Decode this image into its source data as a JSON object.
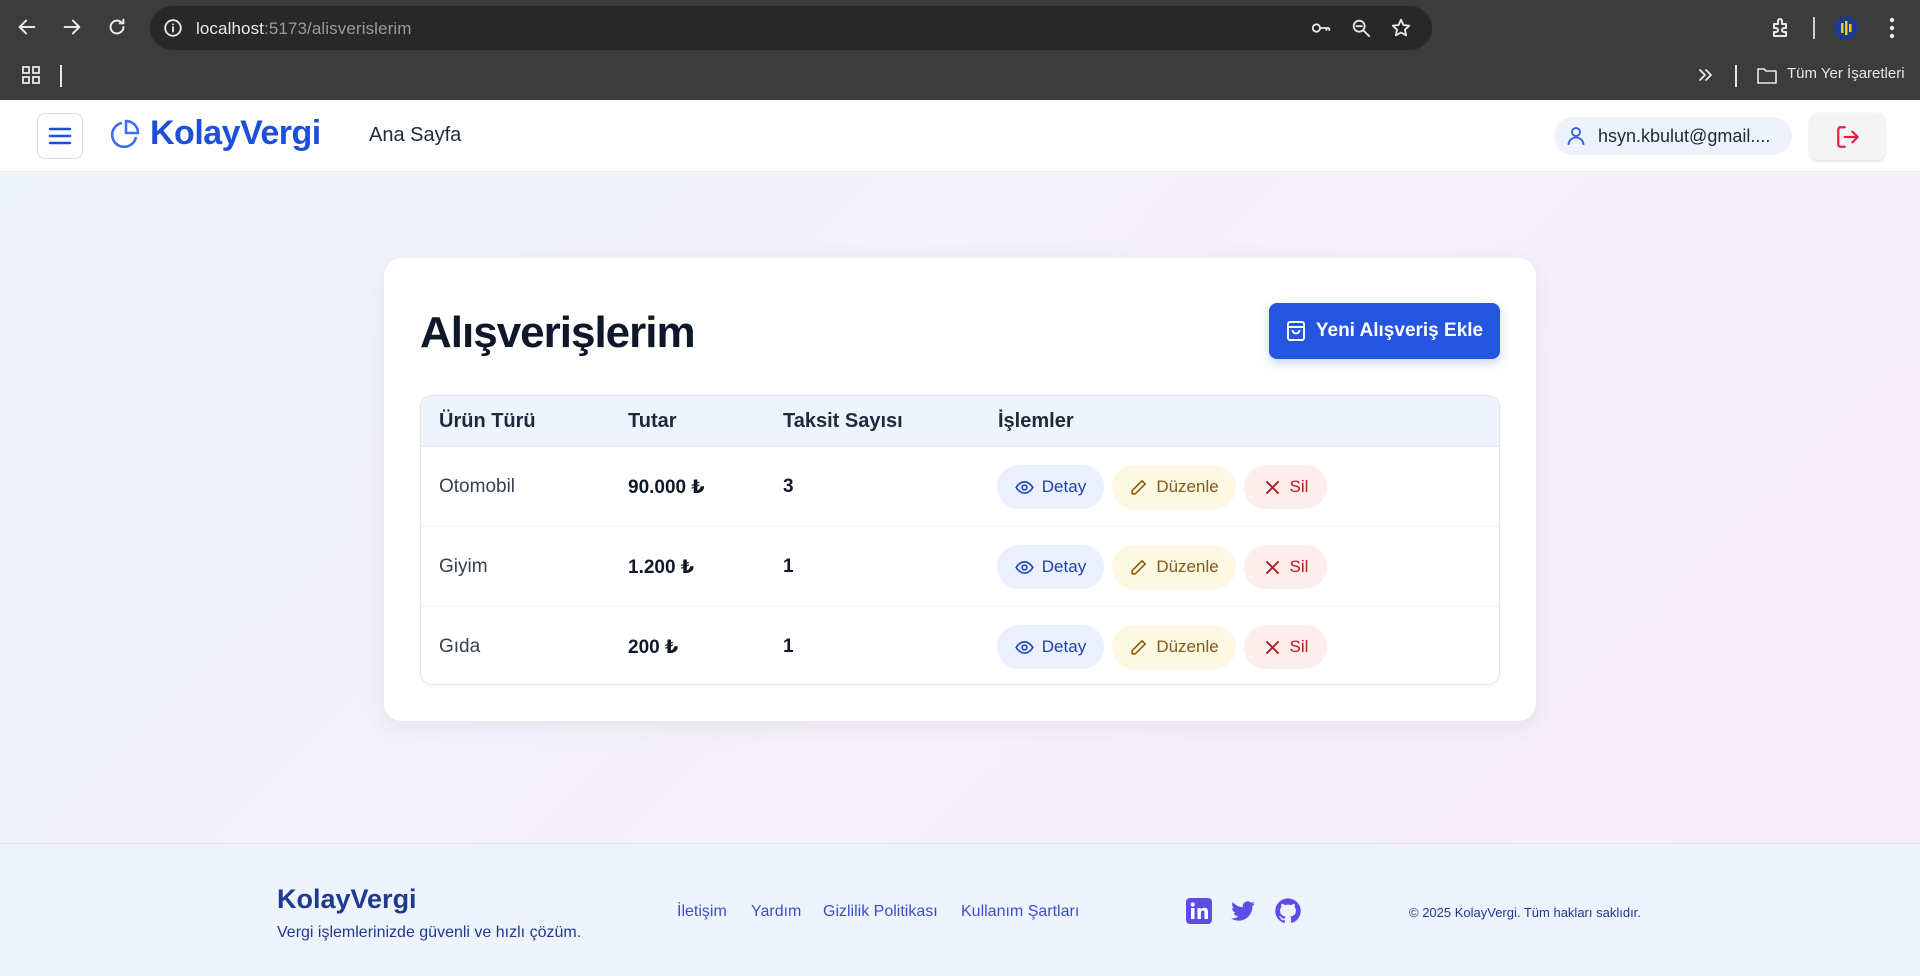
{
  "browser": {
    "url_host": "localhost",
    "url_path": ":5173/alisverislerim",
    "bookmarks_label": "Tüm Yer İşaretleri",
    "icons": [
      "back-icon",
      "forward-icon",
      "reload-icon",
      "info-icon",
      "key-icon",
      "zoom-icon",
      "star-icon",
      "extensions-icon",
      "profile-icon",
      "menu-dots-icon",
      "apps-grid-icon",
      "chevron-double-right-icon",
      "folder-icon"
    ]
  },
  "header": {
    "logo": "KolayVergi",
    "home_link": "Ana Sayfa",
    "user_email": "hsyn.kbulut@gmail....",
    "accent": "#1d4fd8"
  },
  "page": {
    "title": "Alışverişlerim",
    "add_button": "Yeni Alışveriş Ekle",
    "columns": [
      "Ürün Türü",
      "Tutar",
      "Taksit Sayısı",
      "İşlemler"
    ],
    "rows": [
      {
        "product": "Otomobil",
        "amount": "90.000 ₺",
        "installments": "3"
      },
      {
        "product": "Giyim",
        "amount": "1.200 ₺",
        "installments": "1"
      },
      {
        "product": "Gıda",
        "amount": "200 ₺",
        "installments": "1"
      }
    ],
    "actions": {
      "detail": "Detay",
      "edit": "Düzenle",
      "delete": "Sil"
    }
  },
  "footer": {
    "brand": "KolayVergi",
    "tagline": "Vergi işlemlerinizde güvenli ve hızlı çözüm.",
    "links": [
      "İletişim",
      "Yardım",
      "Gizlilik Politikası",
      "Kullanım Şartları"
    ],
    "social": [
      "linkedin-icon",
      "twitter-icon",
      "github-icon"
    ],
    "copyright": "© 2025 KolayVergi. Tüm hakları saklıdır."
  }
}
